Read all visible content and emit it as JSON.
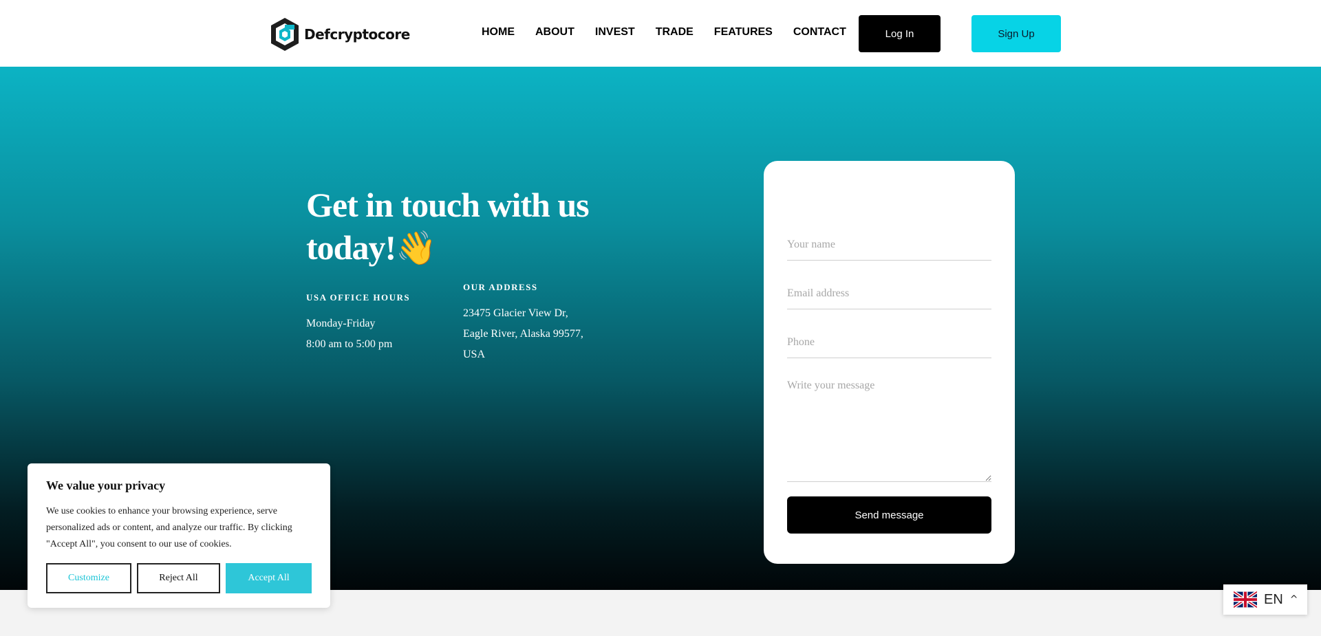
{
  "header": {
    "logo_text": "Defcryptocore",
    "nav": [
      "HOME",
      "ABOUT",
      "INVEST",
      "TRADE",
      "FEATURES",
      "CONTACT"
    ],
    "login_label": "Log In",
    "signup_label": "Sign Up"
  },
  "hero": {
    "title_line1": "Get in touch with us",
    "title_line2": "today!",
    "wave_emoji": "👋",
    "hours_label": "USA OFFICE HOURS",
    "hours_line1": "Monday-Friday",
    "hours_line2": "8:00 am to 5:00 pm",
    "address_label": "OUR ADDRESS",
    "address_line1": "23475 Glacier View Dr,",
    "address_line2": "Eagle River, Alaska 99577,",
    "address_line3": "USA"
  },
  "form": {
    "name_placeholder": "Your name",
    "email_placeholder": "Email address",
    "phone_placeholder": "Phone",
    "message_placeholder": "Write your message",
    "send_label": "Send message"
  },
  "cookie": {
    "title": "We value your privacy",
    "text": "We use cookies to enhance your browsing experience, serve personalized ads or content, and analyze our traffic. By clicking \"Accept All\", you consent to our use of cookies.",
    "customize_label": "Customize",
    "reject_label": "Reject All",
    "accept_label": "Accept All"
  },
  "language": {
    "code": "EN",
    "flag_icon": "uk-flag-icon",
    "chevron_icon": "chevron-up-icon"
  },
  "colors": {
    "accent": "#07d3e6",
    "hero_top": "#0cb3c4",
    "hero_bottom": "#010608"
  }
}
